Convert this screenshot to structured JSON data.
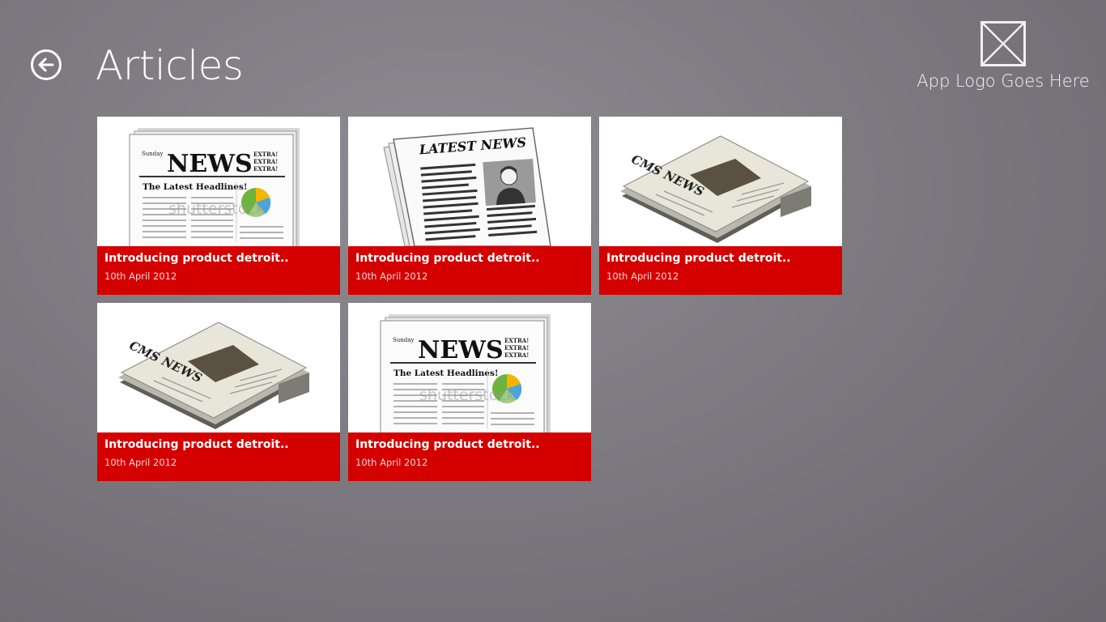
{
  "header": {
    "title": "Articles",
    "back_icon": "back-arrow-icon"
  },
  "logo": {
    "text": "App Logo Goes Here",
    "icon": "logo-placeholder-icon"
  },
  "articles": [
    {
      "title": "Introducing product detroit..",
      "date": "10th April 2012",
      "image": "news-headlines-newspaper"
    },
    {
      "title": "Introducing product detroit..",
      "date": "10th April 2012",
      "image": "latest-news-newspaper"
    },
    {
      "title": "Introducing product detroit..",
      "date": "10th April 2012",
      "image": "folded-newspaper"
    },
    {
      "title": "Introducing product detroit..",
      "date": "10th April 2012",
      "image": "folded-newspaper"
    },
    {
      "title": "Introducing product detroit..",
      "date": "10th April 2012",
      "image": "news-headlines-newspaper"
    }
  ],
  "thumb_text": {
    "news": "NEWS",
    "sunday": "Sunday",
    "extra": "EXTRA!",
    "headlines": "The Latest Headlines!",
    "latest_news": "LATEST NEWS",
    "cms_news": "CMS NEWS",
    "watermark": "shutterstock"
  },
  "colors": {
    "accent": "#d40000",
    "background": "#7d7a80",
    "text": "#ffffff"
  }
}
